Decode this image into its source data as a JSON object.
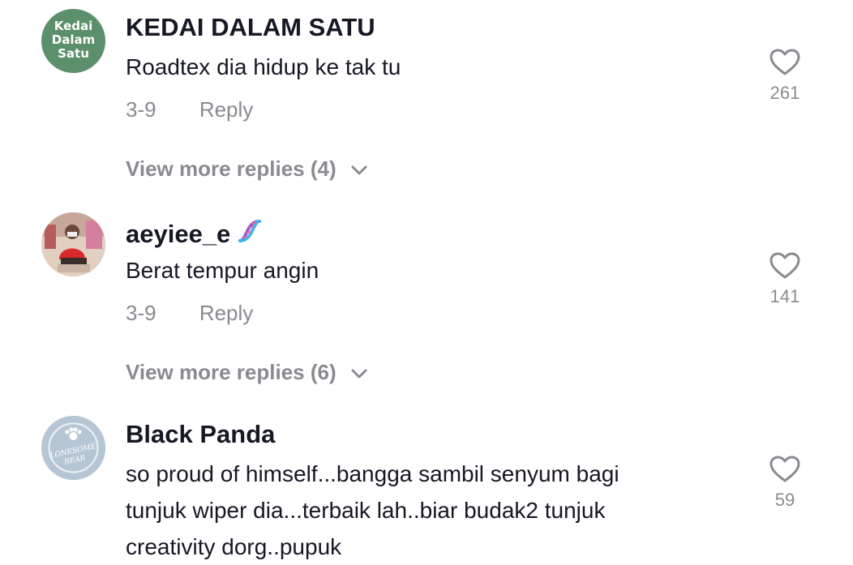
{
  "comments": [
    {
      "username": "KEDAI DALAM SATU",
      "avatar_text": [
        "Kedai",
        "Dalam",
        "Satu"
      ],
      "avatar_color": "#5c8f6b",
      "text": "Roadtex dia hidup ke tak tu",
      "date": "3-9",
      "reply_label": "Reply",
      "likes": "261",
      "more_replies": "View more replies (4)"
    },
    {
      "username": "aeyiee_e",
      "username_emoji": "dna-icon",
      "text": "Berat tempur angin",
      "date": "3-9",
      "reply_label": "Reply",
      "likes": "141",
      "more_replies": "View more replies (6)"
    },
    {
      "username": "Black Panda",
      "avatar_text": [
        "LONESOME",
        "BEAR"
      ],
      "text_lines": [
        "so proud of himself...bangga sambil senyum bagi",
        "tunjuk wiper dia...terbaik lah..biar budak2 tunjuk",
        "creativity dorg..pupuk"
      ],
      "likes": "59"
    }
  ],
  "colors": {
    "text_primary": "#161823",
    "text_secondary": "#8a8b91"
  }
}
